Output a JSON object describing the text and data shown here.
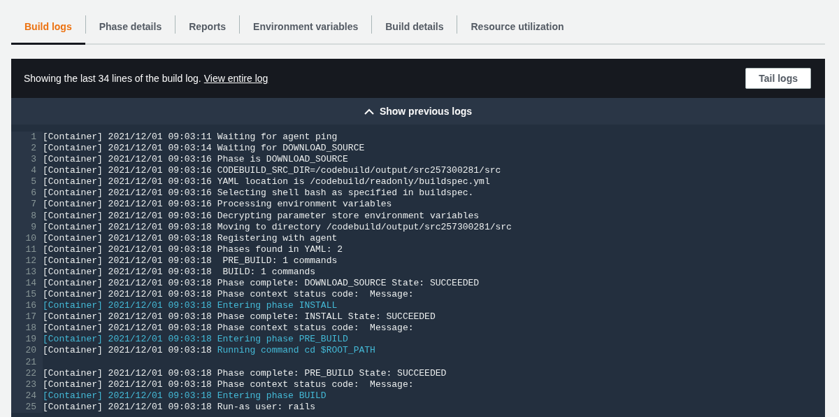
{
  "tabs": [
    {
      "label": "Build logs",
      "selected": true
    },
    {
      "label": "Phase details",
      "selected": false
    },
    {
      "label": "Reports",
      "selected": false
    },
    {
      "label": "Environment variables",
      "selected": false
    },
    {
      "label": "Build details",
      "selected": false
    },
    {
      "label": "Resource utilization",
      "selected": false
    }
  ],
  "log_header": {
    "message": "Showing the last 34 lines of the build log.",
    "link": "View entire log",
    "button": "Tail logs"
  },
  "show_previous": "Show previous logs",
  "lines": [
    {
      "number": "1",
      "parts": [
        {
          "text": "[Container] 2021/12/01 09:03:11 Waiting for agent ping",
          "highlighted": false
        }
      ]
    },
    {
      "number": "2",
      "parts": [
        {
          "text": "[Container] 2021/12/01 09:03:14 Waiting for DOWNLOAD_SOURCE",
          "highlighted": false
        }
      ]
    },
    {
      "number": "3",
      "parts": [
        {
          "text": "[Container] 2021/12/01 09:03:16 Phase is DOWNLOAD_SOURCE",
          "highlighted": false
        }
      ]
    },
    {
      "number": "4",
      "parts": [
        {
          "text": "[Container] 2021/12/01 09:03:16 CODEBUILD_SRC_DIR=/codebuild/output/src257300281/src",
          "highlighted": false
        }
      ]
    },
    {
      "number": "5",
      "parts": [
        {
          "text": "[Container] 2021/12/01 09:03:16 YAML location is /codebuild/readonly/buildspec.yml",
          "highlighted": false
        }
      ]
    },
    {
      "number": "6",
      "parts": [
        {
          "text": "[Container] 2021/12/01 09:03:16 Selecting shell bash as specified in buildspec.",
          "highlighted": false
        }
      ]
    },
    {
      "number": "7",
      "parts": [
        {
          "text": "[Container] 2021/12/01 09:03:16 Processing environment variables",
          "highlighted": false
        }
      ]
    },
    {
      "number": "8",
      "parts": [
        {
          "text": "[Container] 2021/12/01 09:03:16 Decrypting parameter store environment variables",
          "highlighted": false
        }
      ]
    },
    {
      "number": "9",
      "parts": [
        {
          "text": "[Container] 2021/12/01 09:03:18 Moving to directory /codebuild/output/src257300281/src",
          "highlighted": false
        }
      ]
    },
    {
      "number": "10",
      "parts": [
        {
          "text": "[Container] 2021/12/01 09:03:18 Registering with agent",
          "highlighted": false
        }
      ]
    },
    {
      "number": "11",
      "parts": [
        {
          "text": "[Container] 2021/12/01 09:03:18 Phases found in YAML: 2",
          "highlighted": false
        }
      ]
    },
    {
      "number": "12",
      "parts": [
        {
          "text": "[Container] 2021/12/01 09:03:18  PRE_BUILD: 1 commands",
          "highlighted": false
        }
      ]
    },
    {
      "number": "13",
      "parts": [
        {
          "text": "[Container] 2021/12/01 09:03:18  BUILD: 1 commands",
          "highlighted": false
        }
      ]
    },
    {
      "number": "14",
      "parts": [
        {
          "text": "[Container] 2021/12/01 09:03:18 Phase complete: DOWNLOAD_SOURCE State: SUCCEEDED",
          "highlighted": false
        }
      ]
    },
    {
      "number": "15",
      "parts": [
        {
          "text": "[Container] 2021/12/01 09:03:18 Phase context status code:  Message:",
          "highlighted": false
        }
      ]
    },
    {
      "number": "16",
      "parts": [
        {
          "text": "[Container] 2021/12/01 09:03:18 Entering phase INSTALL",
          "highlighted": true
        }
      ]
    },
    {
      "number": "17",
      "parts": [
        {
          "text": "[Container] 2021/12/01 09:03:18 Phase complete: INSTALL State: SUCCEEDED",
          "highlighted": false
        }
      ]
    },
    {
      "number": "18",
      "parts": [
        {
          "text": "[Container] 2021/12/01 09:03:18 Phase context status code:  Message:",
          "highlighted": false
        }
      ]
    },
    {
      "number": "19",
      "parts": [
        {
          "text": "[Container] 2021/12/01 09:03:18 Entering phase PRE_BUILD",
          "highlighted": true
        }
      ]
    },
    {
      "number": "20",
      "parts": [
        {
          "text": "[Container] 2021/12/01 09:03:18 ",
          "highlighted": false
        },
        {
          "text": "Running command cd $ROOT_PATH",
          "highlighted": true
        }
      ]
    },
    {
      "number": "21"
    },
    {
      "number": "22",
      "parts": [
        {
          "text": "[Container] 2021/12/01 09:03:18 Phase complete: PRE_BUILD State: SUCCEEDED",
          "highlighted": false
        }
      ]
    },
    {
      "number": "23",
      "parts": [
        {
          "text": "[Container] 2021/12/01 09:03:18 Phase context status code:  Message:",
          "highlighted": false
        }
      ]
    },
    {
      "number": "24",
      "parts": [
        {
          "text": "[Container] 2021/12/01 09:03:18 Entering phase BUILD",
          "highlighted": true
        }
      ]
    },
    {
      "number": "25",
      "parts": [
        {
          "text": "[Container] 2021/12/01 09:03:18 Run-as user: rails",
          "highlighted": false
        }
      ]
    }
  ]
}
